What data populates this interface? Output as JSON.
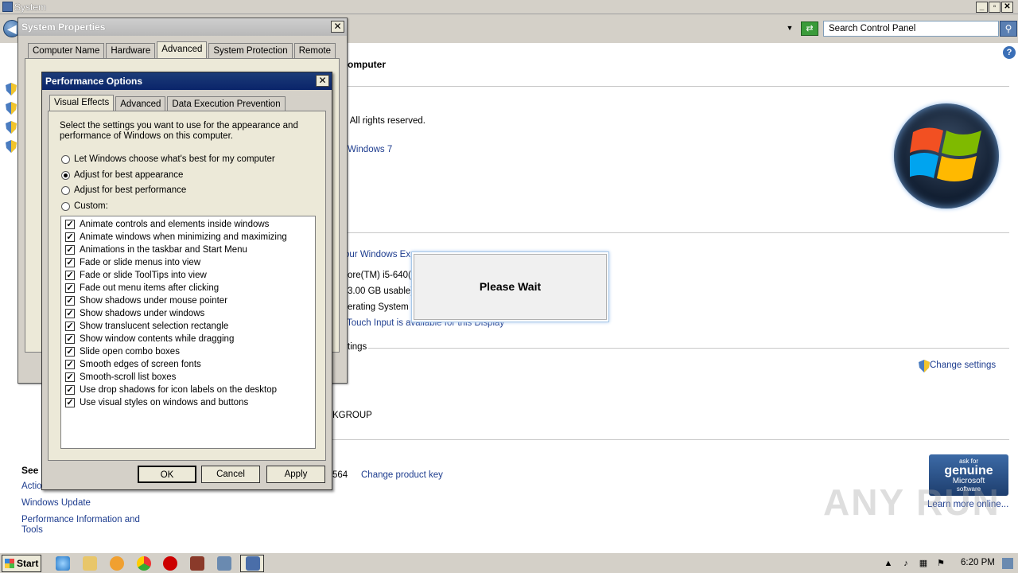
{
  "window": {
    "title": "System"
  },
  "address": {
    "search_placeholder": "Search Control Panel"
  },
  "main": {
    "heading_partial": "omputer",
    "copyright": ".  All rights reserved.",
    "edition_partial": "Windows 7",
    "experience_partial": "our Windows Exp",
    "processor_partial": "ore(TM) i5-640(",
    "memory_partial": "3.00 GB usable)",
    "system_type_partial": "erating System",
    "touch_partial": "Touch Input is available for this Display",
    "settings_partial": "tings",
    "change_settings": "Change settings",
    "workgroup_partial": "KGROUP",
    "product_id_partial": "564",
    "change_product_key": "Change product key",
    "see_also": "See",
    "action_partial": "Actio",
    "windows_update": "Windows Update",
    "perf_info_1": "Performance Information and",
    "perf_info_2": "Tools",
    "learn_more": "Learn more online..."
  },
  "genuine": {
    "line1": "ask for",
    "line2": "genuine",
    "line3": "Microsoft",
    "line4": "software"
  },
  "watermark": "ANY RUN",
  "system_properties": {
    "title": "System Properties",
    "tabs": [
      "Computer Name",
      "Hardware",
      "Advanced",
      "System Protection",
      "Remote"
    ]
  },
  "performance_options": {
    "title": "Performance Options",
    "tabs": [
      "Visual Effects",
      "Advanced",
      "Data Execution Prevention"
    ],
    "description": "Select the settings you want to use for the appearance and performance of Windows on this computer.",
    "radios": [
      {
        "label": "Let Windows choose what's best for my computer",
        "selected": false
      },
      {
        "label": "Adjust for best appearance",
        "selected": true
      },
      {
        "label": "Adjust for best performance",
        "selected": false
      },
      {
        "label": "Custom:",
        "selected": false
      }
    ],
    "effects": [
      "Animate controls and elements inside windows",
      "Animate windows when minimizing and maximizing",
      "Animations in the taskbar and Start Menu",
      "Fade or slide menus into view",
      "Fade or slide ToolTips into view",
      "Fade out menu items after clicking",
      "Show shadows under mouse pointer",
      "Show shadows under windows",
      "Show translucent selection rectangle",
      "Show window contents while dragging",
      "Slide open combo boxes",
      "Smooth edges of screen fonts",
      "Smooth-scroll list boxes",
      "Use drop shadows for icon labels on the desktop",
      "Use visual styles on windows and buttons"
    ],
    "buttons": {
      "ok": "OK",
      "cancel": "Cancel",
      "apply": "Apply"
    }
  },
  "please_wait": "Please Wait",
  "taskbar": {
    "start": "Start",
    "time": "6:20 PM"
  },
  "colors": {
    "dialog_bg": "#d4d0c8",
    "perf_title": "#0a246a",
    "link": "#1e3d8f"
  }
}
